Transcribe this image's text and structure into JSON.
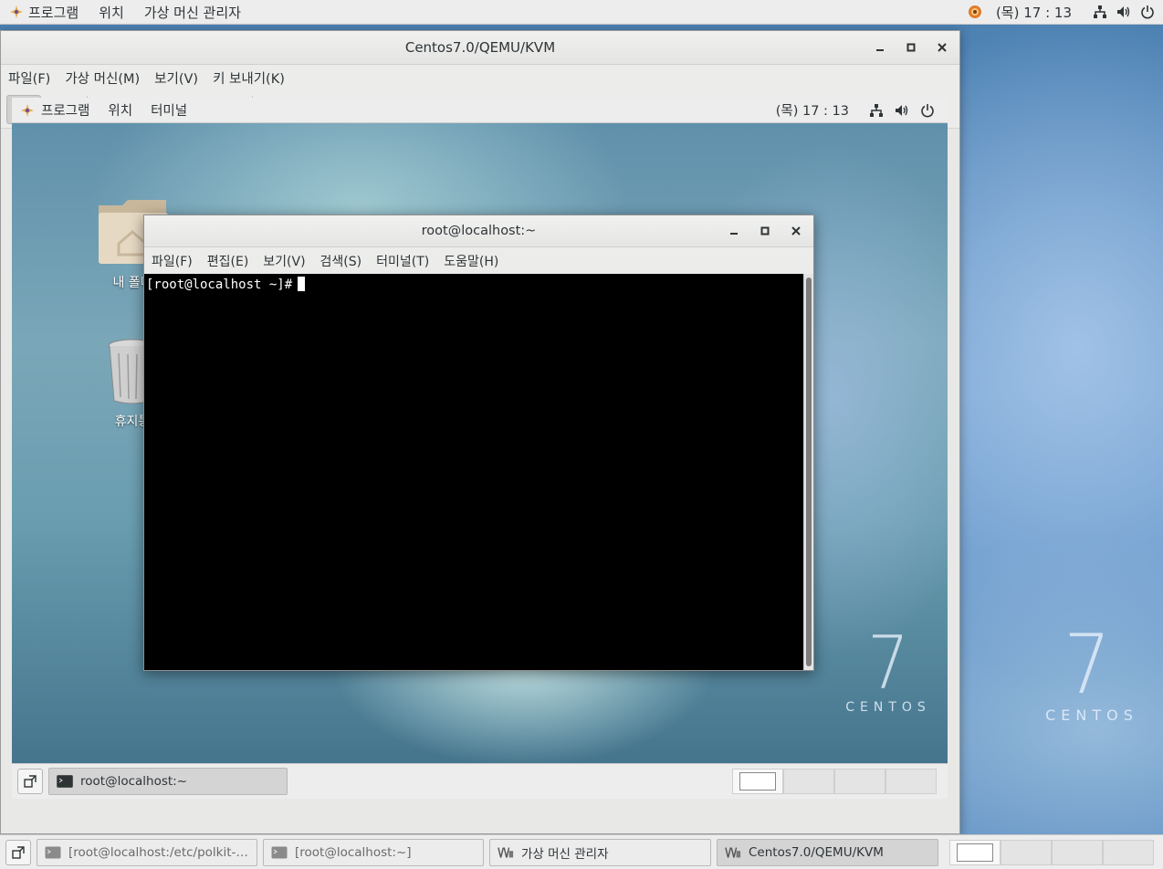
{
  "host": {
    "topbar": {
      "menu": [
        "프로그램",
        "위치",
        "가상 머신 관리자"
      ],
      "clock": "(목) 17 : 13",
      "icons": [
        "applications-icon",
        "updates-icon",
        "network-icon",
        "volume-icon",
        "power-icon"
      ]
    },
    "watermark": {
      "numeral": "7",
      "word": "CENTOS"
    },
    "taskbar": {
      "tasks": [
        {
          "label": "[root@localhost:/etc/polkit-1/lo…",
          "icon": "terminal-icon",
          "active": false
        },
        {
          "label": "[root@localhost:~]",
          "icon": "terminal-icon",
          "active": false
        },
        {
          "label": "가상 머신 관리자",
          "icon": "virt-manager-icon",
          "active": false
        },
        {
          "label": "Centos7.0/QEMU/KVM",
          "icon": "virt-manager-icon",
          "active": true
        }
      ],
      "workspaces": 4,
      "active_workspace": 1
    }
  },
  "vm_window": {
    "title": "Centos7.0/QEMU/KVM",
    "menu": [
      "파일(F)",
      "가상 머신(M)",
      "보기(V)",
      "키 보내기(K)"
    ],
    "toolbar": [
      "console-icon",
      "details-icon",
      "run-icon",
      "pause-icon",
      "shutdown-icon",
      "shutdown-menu-icon",
      "snapshots-icon",
      "fullscreen-icon"
    ]
  },
  "guest": {
    "topbar": {
      "menu": [
        "프로그램",
        "위치",
        "터미널"
      ],
      "clock": "(목) 17 : 13"
    },
    "desktop_icons": [
      {
        "label": "내 폴더"
      },
      {
        "label": "휴지통"
      }
    ],
    "watermark": {
      "numeral": "7",
      "word": "CENTOS"
    },
    "terminal": {
      "title": "root@localhost:~",
      "menu": [
        "파일(F)",
        "편집(E)",
        "보기(V)",
        "검색(S)",
        "터미널(T)",
        "도움말(H)"
      ],
      "prompt": "[root@localhost ~]#"
    },
    "taskbar": {
      "task": "root@localhost:~",
      "workspaces": 4
    }
  },
  "colors": {
    "panel": "#ededed",
    "terminal_bg": "#000000",
    "terminal_fg": "#ffffff"
  }
}
